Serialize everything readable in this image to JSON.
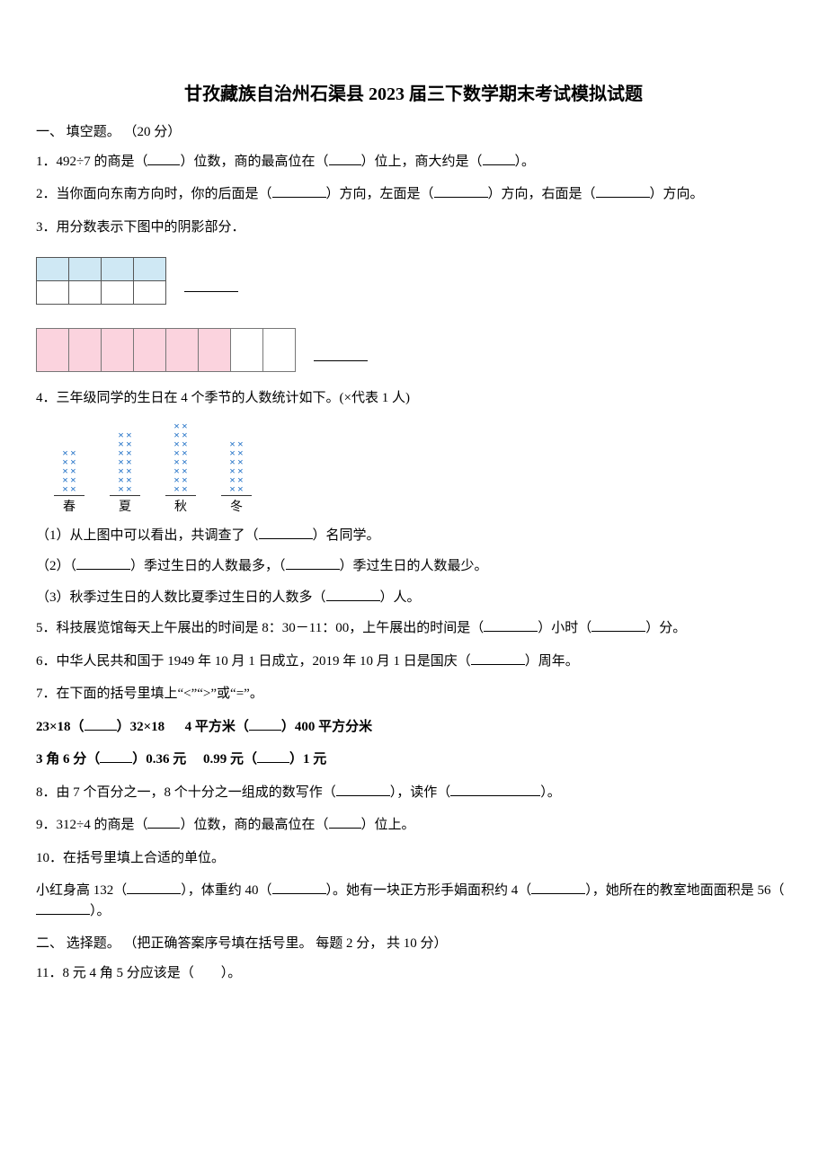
{
  "title": "甘孜藏族自治州石渠县 2023 届三下数学期末考试模拟试题",
  "section1": {
    "heading": "一、 填空题。 （20 分）"
  },
  "q1": {
    "p1": "1．492÷7 的商是（",
    "p2": "）位数，商的最高位在（",
    "p3": "）位上，商大约是（",
    "p4": "）。"
  },
  "q2": {
    "p1": "2．当你面向东南方向时，你的后面是（",
    "p2": "）方向，左面是（",
    "p3": "）方向，右面是（",
    "p4": "）方向。"
  },
  "q3": {
    "text": "3．用分数表示下图中的阴影部分．"
  },
  "q4": {
    "text": "4．三年级同学的生日在 4 个季节的人数统计如下。(×代表 1 人)",
    "labels": [
      "春",
      "夏",
      "秋",
      "冬"
    ],
    "sub1": {
      "p1": "（1）从上图中可以看出，共调查了（",
      "p2": "）名同学。"
    },
    "sub2": {
      "p1": "（2）（",
      "p2": "）季过生日的人数最多，（",
      "p3": "）季过生日的人数最少。"
    },
    "sub3": {
      "p1": "（3）秋季过生日的人数比夏季过生日的人数多（",
      "p2": "）人。"
    }
  },
  "q5": {
    "p1": "5．科技展览馆每天上午展出的时间是 8：30－11：00，上午展出的时间是（",
    "p2": "）小时（",
    "p3": "）分。"
  },
  "q6": {
    "p1": "6．中华人民共和国于 1949 年 10 月 1 日成立，2019 年 10 月 1 日是国庆（",
    "p2": "）周年。"
  },
  "q7": {
    "intro": "7．在下面的括号里填上“<”“>”或“=”。",
    "l1a": "23×18（",
    "l1b": "）32×18",
    "l1c": "4 平方米（",
    "l1d": "）400 平方分米",
    "l2a": "3 角 6 分（",
    "l2b": "）0.36 元",
    "l2c": "0.99 元（",
    "l2d": "）1 元"
  },
  "q8": {
    "p1": "8．由 7 个百分之一，8 个十分之一组成的数写作（",
    "p2": "），读作（",
    "p3": "）。"
  },
  "q9": {
    "p1": "9．312÷4 的商是（",
    "p2": "）位数，商的最高位在（",
    "p3": "）位上。"
  },
  "q10": {
    "intro": "10．在括号里填上合适的单位。",
    "p1": "小红身高 132（",
    "p2": "），体重约 40（",
    "p3": "）。她有一块正方形手娟面积约 4（",
    "p4": "），她所在的教室地面面积是 56（",
    "p5": "）。"
  },
  "section2": {
    "heading": "二、 选择题。 （把正确答案序号填在括号里。 每题 2 分， 共 10 分）"
  },
  "q11": {
    "text": "11．8 元 4 角 5 分应该是（　　）。"
  },
  "chart_data": {
    "type": "pictograph",
    "unit_symbol": "×",
    "unit_value": 1,
    "note": "×代表 1 人",
    "categories": [
      "春",
      "夏",
      "秋",
      "冬"
    ],
    "values": [
      10,
      14,
      16,
      12
    ],
    "columns_per_category": 2
  }
}
